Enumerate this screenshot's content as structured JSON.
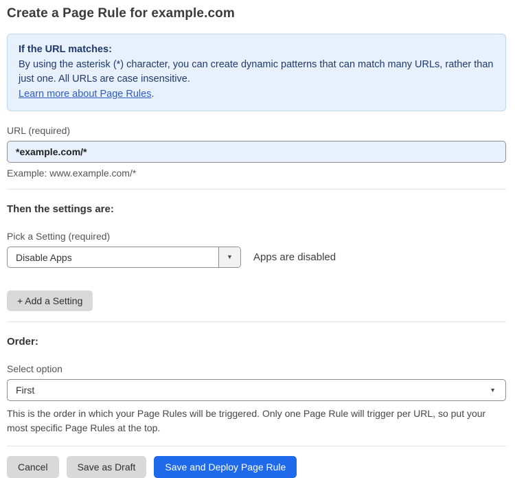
{
  "page": {
    "title": "Create a Page Rule for example.com"
  },
  "info_box": {
    "heading": "If the URL matches:",
    "body": "By using the asterisk (*) character, you can create dynamic patterns that can match many URLs, rather than just one. All URLs are case insensitive.",
    "link_label": "Learn more about Page Rules",
    "link_suffix": "."
  },
  "url_field": {
    "label": "URL (required)",
    "value": "*example.com/*",
    "example": "Example: www.example.com/*"
  },
  "settings": {
    "heading": "Then the settings are:",
    "picker_label": "Pick a Setting (required)",
    "picker_value": "Disable Apps",
    "status_text": "Apps are disabled",
    "add_button_label": "+ Add a Setting"
  },
  "order": {
    "heading": "Order:",
    "select_label": "Select option",
    "select_value": "First",
    "help_text": "This is the order in which your Page Rules will be triggered. Only one Page Rule will trigger per URL, so put your most specific Page Rules at the top."
  },
  "footer": {
    "cancel_label": "Cancel",
    "save_draft_label": "Save as Draft",
    "save_deploy_label": "Save and Deploy Page Rule"
  },
  "icons": {
    "dropdown_caret": "▼"
  },
  "colors": {
    "info_bg": "#e8f1fb",
    "info_border": "#bdd7f0",
    "info_text": "#1e3a6d",
    "link_blue": "#2c5cc5",
    "input_bg": "#e8f0fb",
    "primary_button_blue": "#1f6aeb",
    "gray_button": "#d9d9d9"
  }
}
